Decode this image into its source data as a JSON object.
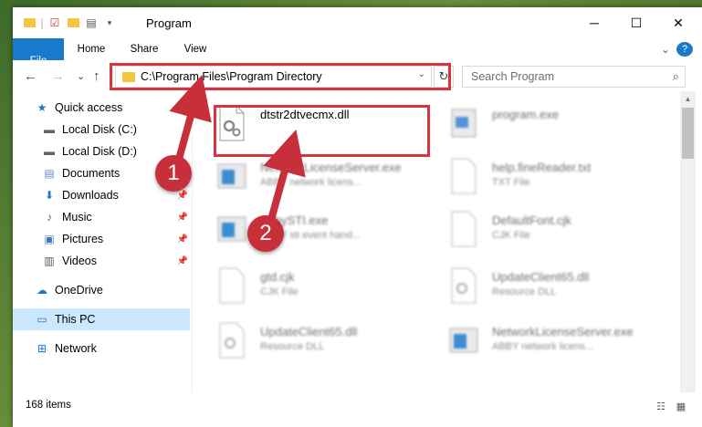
{
  "window": {
    "title": "Program",
    "minimize": "─",
    "maximize": "☐",
    "close": "✕"
  },
  "ribbon": {
    "file": "File",
    "home": "Home",
    "share": "Share",
    "view": "View",
    "expand": "⌄",
    "help": "?"
  },
  "nav": {
    "back": "←",
    "forward": "→",
    "recent": "⌄",
    "up": "↑",
    "address": "C:\\Program Files\\Program Directory",
    "address_dropdown": "⌄",
    "refresh": "↻",
    "search_placeholder": "Search Program",
    "search_icon": "⌕"
  },
  "sidebar": [
    {
      "label": "Quick access",
      "icon": "star-icon"
    },
    {
      "label": "Local Disk (C:)",
      "icon": "drive-icon"
    },
    {
      "label": "Local Disk (D:)",
      "icon": "drive-icon"
    },
    {
      "label": "Documents",
      "icon": "documents-icon"
    },
    {
      "label": "Downloads",
      "icon": "download-icon"
    },
    {
      "label": "Music",
      "icon": "music-icon"
    },
    {
      "label": "Pictures",
      "icon": "pictures-icon"
    },
    {
      "label": "Videos",
      "icon": "videos-icon"
    },
    {
      "label": "OneDrive",
      "icon": "cloud-icon"
    },
    {
      "label": "This PC",
      "icon": "computer-icon"
    },
    {
      "label": "Network",
      "icon": "network-icon"
    }
  ],
  "files": [
    {
      "name": "dtstr2dtvecmx.dll",
      "sub": ""
    },
    {
      "name": "program.exe",
      "sub": ""
    },
    {
      "name": "NetworkLicenseServer.exe",
      "sub": "ABBY network licens..."
    },
    {
      "name": "help.fineReader.txt",
      "sub": "TXT File"
    },
    {
      "name": "AbbySTI.exe",
      "sub": "ABBY sti event hand..."
    },
    {
      "name": "DefaultFont.cjk",
      "sub": "CJK File"
    },
    {
      "name": "gtd.cjk",
      "sub": "CJK File"
    },
    {
      "name": "UpdateClient65.dll",
      "sub": "Resource DLL"
    },
    {
      "name": "UpdateClient65.dll",
      "sub": "Resource DLL"
    },
    {
      "name": "NetworkLicenseServer.exe",
      "sub": "ABBY network licens..."
    }
  ],
  "status": {
    "items": "168 items"
  },
  "annotations": {
    "one": "1",
    "two": "2"
  },
  "colors": {
    "accent": "#1979ca",
    "highlight": "#d9333f",
    "selected": "#cce8ff"
  }
}
